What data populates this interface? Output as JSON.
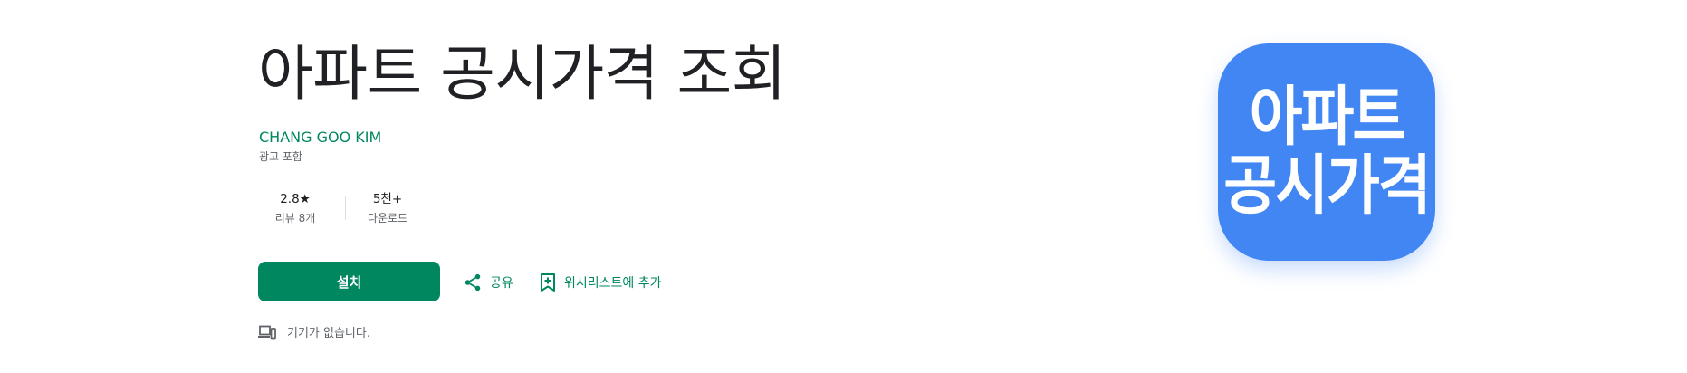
{
  "app": {
    "title": "아파트 공시가격 조회",
    "developer": "CHANG GOO KIM",
    "ads_label": "광고 포함"
  },
  "stats": {
    "rating_value": "2.8★",
    "rating_label": "리뷰 8개",
    "downloads_value": "5천+",
    "downloads_label": "다운로드"
  },
  "actions": {
    "install_label": "설치",
    "share_label": "공유",
    "wishlist_label": "위시리스트에 추가",
    "share_icon": "share-icon",
    "wishlist_icon": "bookmark-add-icon"
  },
  "device_note": {
    "icon": "devices-icon",
    "text": "기기가 없습니다."
  },
  "icon_art": {
    "line1": "아파트",
    "line2": "공시가격",
    "background": "#4286f4"
  },
  "colors": {
    "accent": "#01875f",
    "text": "#202124",
    "secondary": "#5f6368"
  }
}
